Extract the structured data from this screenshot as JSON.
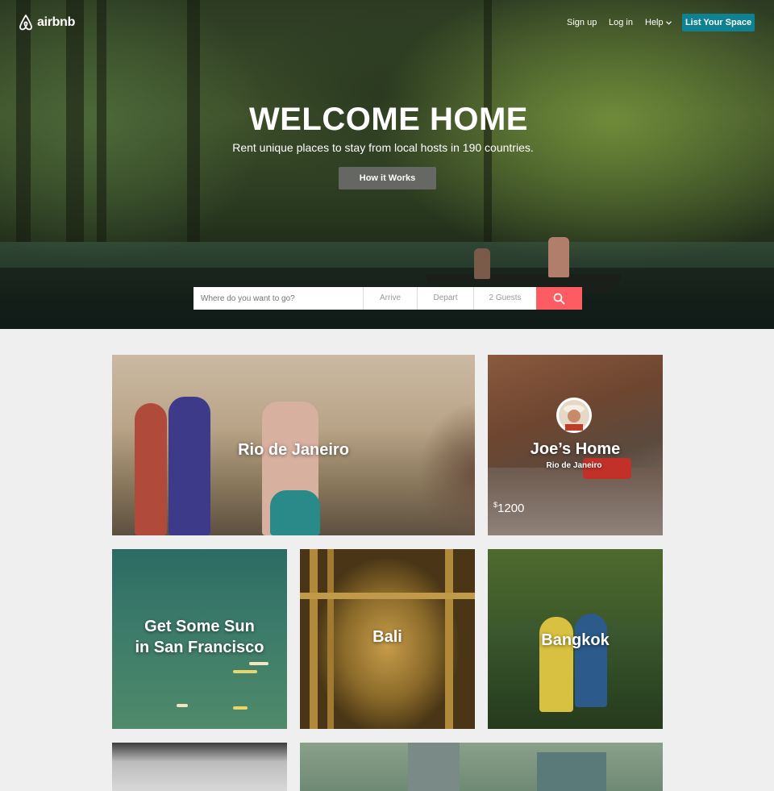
{
  "brand": {
    "name": "airbnb",
    "accent": "#fd5c63",
    "teal": "#0e8192"
  },
  "nav": {
    "sign_up": "Sign up",
    "log_in": "Log in",
    "help": "Help",
    "list_space": "List Your Space"
  },
  "hero": {
    "title": "WELCOME HOME",
    "subtitle": "Rent unique places to stay from local hosts in 190 countries.",
    "how_it_works": "How it Works"
  },
  "search": {
    "where_placeholder": "Where do you want to go?",
    "arrive": "Arrive",
    "depart": "Depart",
    "guests": "2 Guests",
    "icon": "search-icon"
  },
  "tiles": {
    "rio": {
      "label": "Rio de Janeiro"
    },
    "joe": {
      "label": "Joe’s Home",
      "location": "Rio de Janeiro",
      "price_currency": "$",
      "price_amount": "1200"
    },
    "sf": {
      "line1": "Get Some Sun",
      "line2": "in San Francisco"
    },
    "bali": {
      "label": "Bali"
    },
    "bangkok": {
      "label": "Bangkok"
    }
  }
}
